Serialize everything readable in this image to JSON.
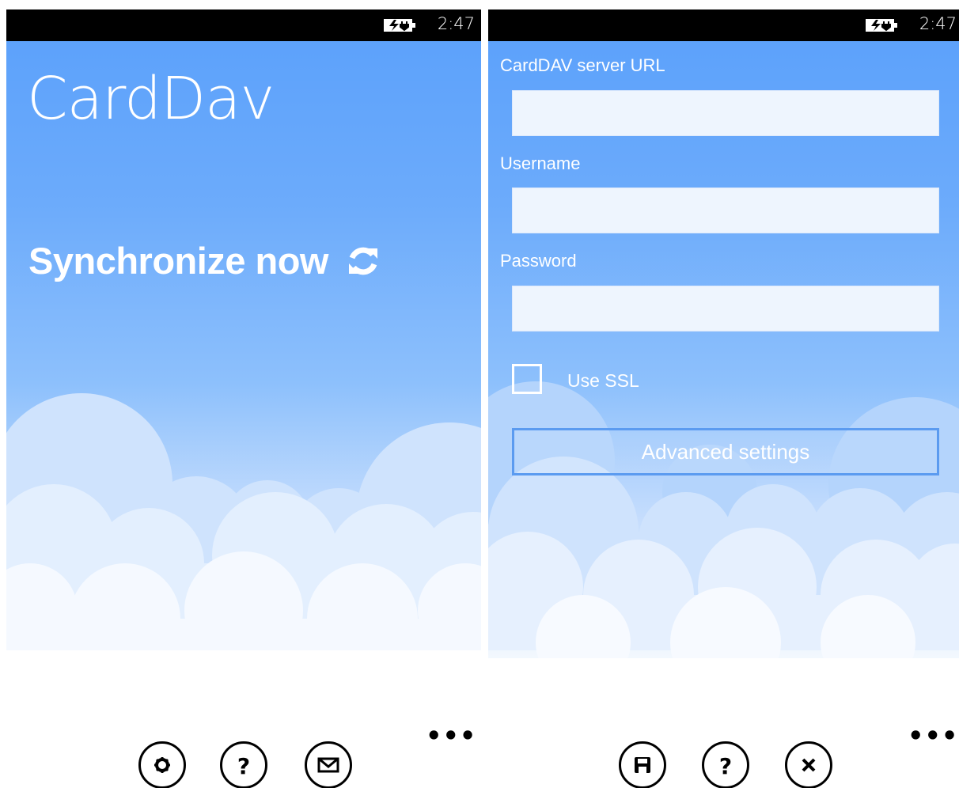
{
  "status": {
    "time": "2:47"
  },
  "main": {
    "title": "CardDav",
    "sync_label": "Synchronize now",
    "appbar": [
      "settings-icon",
      "help-icon",
      "mail-icon"
    ]
  },
  "settings": {
    "server_url_label": "CardDAV server URL",
    "server_url_value": "",
    "username_label": "Username",
    "username_value": "",
    "password_label": "Password",
    "password_value": "",
    "ssl_label": "Use SSL",
    "ssl_checked": false,
    "advanced_label": "Advanced settings",
    "appbar": [
      "save-icon",
      "help-icon",
      "close-icon"
    ]
  },
  "colors": {
    "sky_top": "#5aa0fb",
    "status_bar": "#000000",
    "button_border": "#5b9bf0"
  }
}
